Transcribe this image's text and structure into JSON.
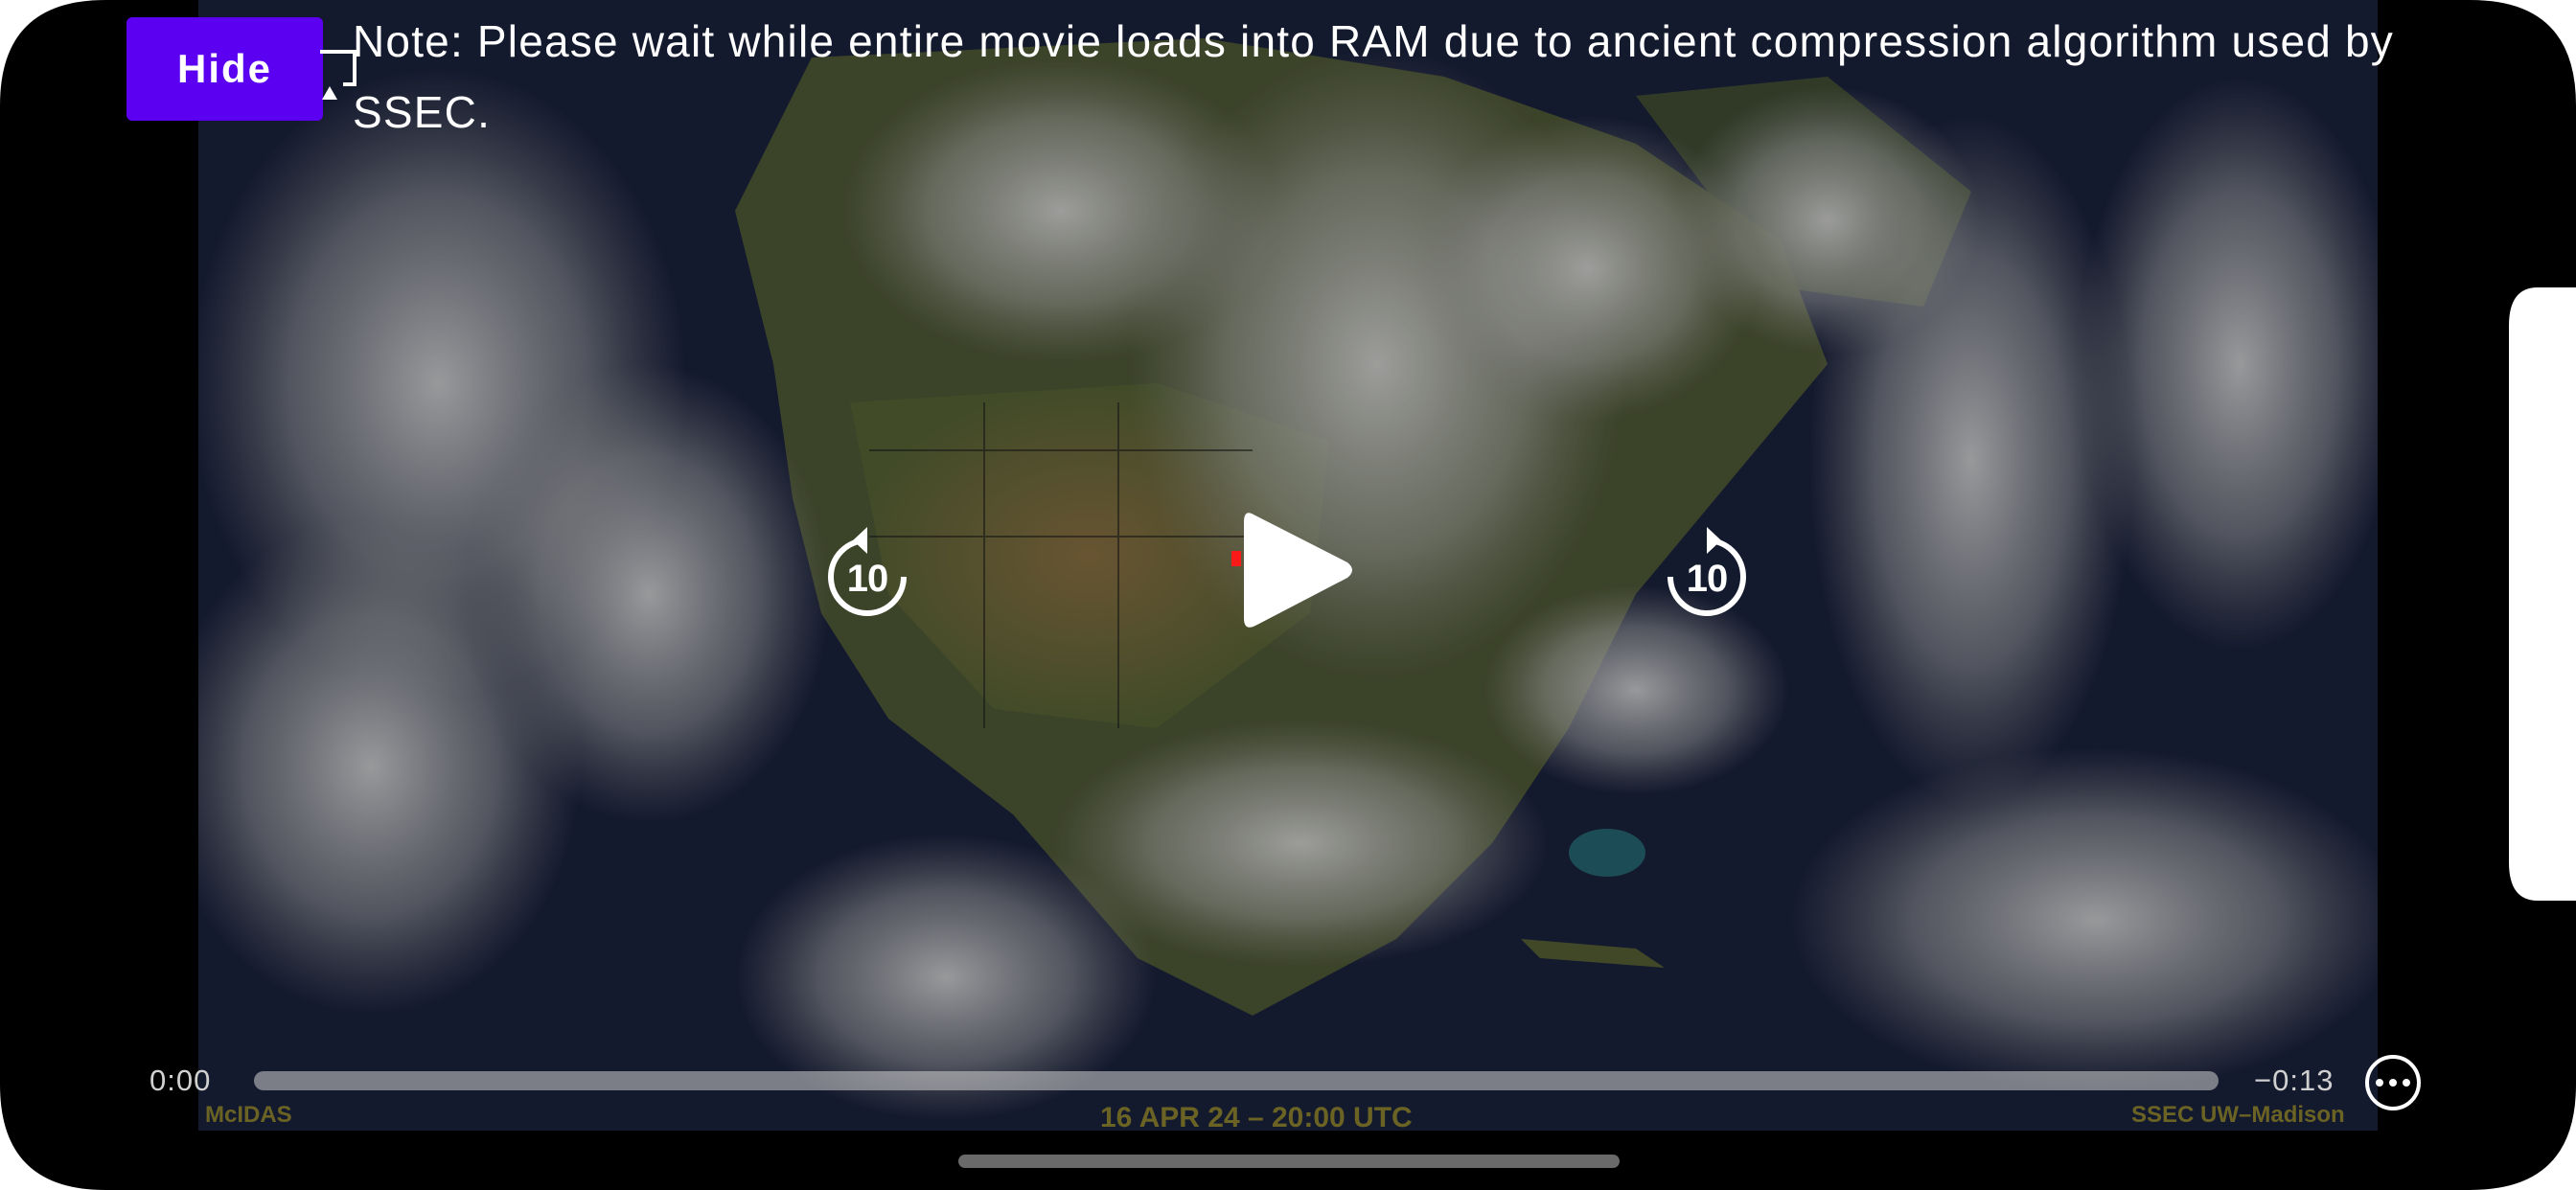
{
  "app": {
    "hide_label": "Hide",
    "note": "Note: Please wait while entire movie loads into RAM due to ancient compression algorithm used by SSEC."
  },
  "player": {
    "rewind_seconds": "10",
    "forward_seconds": "10",
    "time_elapsed": "0:00",
    "time_remaining": "−0:13",
    "progress": 0.0,
    "icons": {
      "play": "play-icon",
      "rewind": "rewind-10-icon",
      "forward": "forward-10-icon",
      "more": "more-icon"
    }
  },
  "video_captions": {
    "left": "McIDAS",
    "center": "16 APR 24 – 20:00 UTC",
    "right": "SSEC UW–Madison"
  },
  "colors": {
    "accent": "#5b00f0",
    "caption": "#6b6324",
    "scrubber": "#d2d2d2"
  }
}
